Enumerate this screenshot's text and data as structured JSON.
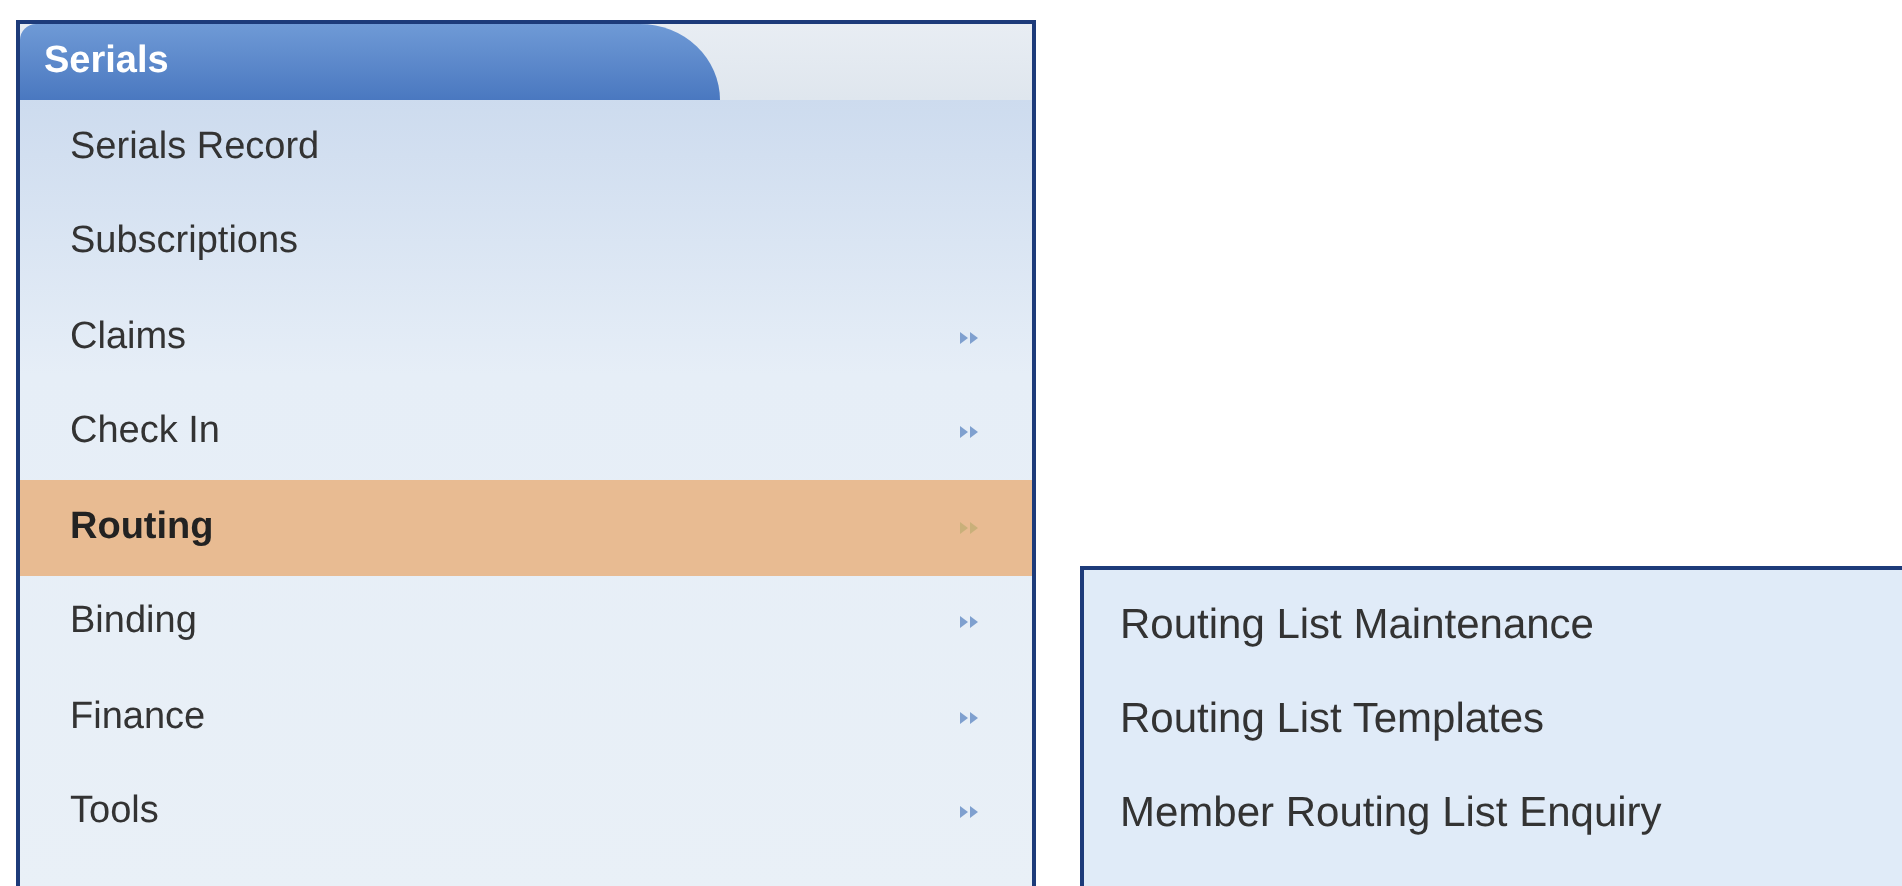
{
  "menu": {
    "title": "Serials",
    "items": [
      {
        "label": "Serials Record",
        "selected": false,
        "has_submenu": false
      },
      {
        "label": "Subscriptions",
        "selected": false,
        "has_submenu": false
      },
      {
        "label": "Claims",
        "selected": false,
        "has_submenu": true
      },
      {
        "label": "Check In",
        "selected": false,
        "has_submenu": true
      },
      {
        "label": "Routing",
        "selected": true,
        "has_submenu": true
      },
      {
        "label": "Binding",
        "selected": false,
        "has_submenu": true
      },
      {
        "label": "Finance",
        "selected": false,
        "has_submenu": true
      },
      {
        "label": "Tools",
        "selected": false,
        "has_submenu": true
      }
    ]
  },
  "submenu": {
    "items": [
      {
        "label": "Routing List Maintenance"
      },
      {
        "label": "Routing List Templates"
      },
      {
        "label": "Member Routing List Enquiry"
      }
    ]
  }
}
